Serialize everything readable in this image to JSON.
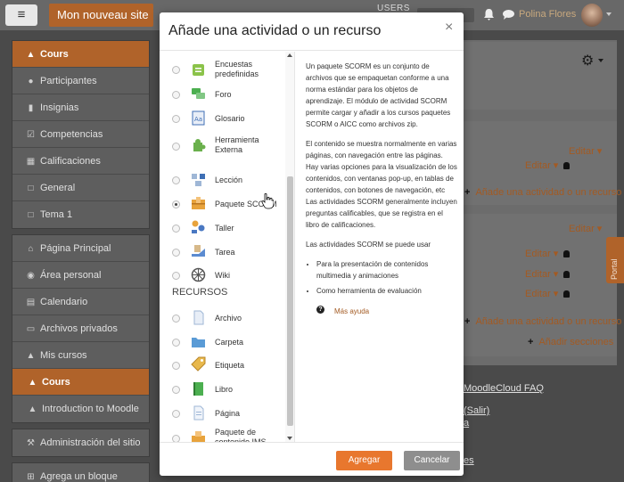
{
  "navbar": {
    "site_name": "Mon nouveau site",
    "users_label": "USERS",
    "user_name": "Polina Flores"
  },
  "sidebar": {
    "course_group": [
      {
        "label": "Cours",
        "icon": "graduation-cap-icon",
        "active": true
      },
      {
        "label": "Participantes",
        "icon": "users-icon"
      },
      {
        "label": "Insignias",
        "icon": "shield-icon"
      },
      {
        "label": "Competencias",
        "icon": "checkbox-icon"
      },
      {
        "label": "Calificaciones",
        "icon": "table-icon"
      },
      {
        "label": "General",
        "icon": "folder-icon"
      },
      {
        "label": "Tema 1",
        "icon": "folder-icon"
      }
    ],
    "site_group": [
      {
        "label": "Página Principal",
        "icon": "home-icon"
      },
      {
        "label": "Área personal",
        "icon": "dashboard-icon"
      },
      {
        "label": "Calendario",
        "icon": "calendar-icon"
      },
      {
        "label": "Archivos privados",
        "icon": "file-icon"
      },
      {
        "label": "Mis cursos",
        "icon": "graduation-cap-icon"
      },
      {
        "label": "Cours",
        "icon": "graduation-cap-icon",
        "active": true
      },
      {
        "label": "Introduction to Moodle",
        "icon": "graduation-cap-icon",
        "indent": true
      }
    ],
    "admin_item": {
      "label": "Administración del sitio",
      "icon": "wrench-icon"
    },
    "add_block_item": {
      "label": "Agrega un bloque",
      "icon": "plus-square-icon"
    }
  },
  "background": {
    "edit_label": "Editar",
    "add_activity_label": "Añade una actividad o un recurso",
    "add_sections_label": "Añadir secciones",
    "faq_link": "MoodleCloud FAQ",
    "logout_link": "(Salir)",
    "partial_link_1": "a",
    "partial_link_2": "es",
    "portal_label": "Portal"
  },
  "modal": {
    "title": "Añade una actividad o un recurso",
    "close_glyph": "×",
    "activities": [
      {
        "label": "Encuestas predefinidas",
        "icon": "survey-icon",
        "color": "#8bc34a"
      },
      {
        "label": "Foro",
        "icon": "forum-icon",
        "color": "#4caf50"
      },
      {
        "label": "Glosario",
        "icon": "glossary-icon",
        "color": "#3f6fb5"
      },
      {
        "label": "Herramienta Externa",
        "icon": "puzzle-icon",
        "color": "#6ab04c"
      },
      {
        "label": "Lección",
        "icon": "lesson-icon",
        "color": "#3f6fb5"
      },
      {
        "label": "Paquete SCORM",
        "icon": "scorm-icon",
        "color": "#e8a33c",
        "selected": true
      },
      {
        "label": "Taller",
        "icon": "workshop-icon",
        "color": "#4a78c2"
      },
      {
        "label": "Tarea",
        "icon": "assignment-icon",
        "color": "#5b8bd0"
      },
      {
        "label": "Wiki",
        "icon": "wiki-icon",
        "color": "#555555"
      }
    ],
    "resources_heading": "RECURSOS",
    "resources": [
      {
        "label": "Archivo",
        "icon": "file-icon",
        "color": "#9fb7d6"
      },
      {
        "label": "Carpeta",
        "icon": "folder-icon",
        "color": "#5a9bd6"
      },
      {
        "label": "Etiqueta",
        "icon": "tag-icon",
        "color": "#e8b84c"
      },
      {
        "label": "Libro",
        "icon": "book-icon",
        "color": "#4caf50"
      },
      {
        "label": "Página",
        "icon": "page-icon",
        "color": "#9fb7d6"
      },
      {
        "label": "Paquete de contenido IMS",
        "icon": "ims-icon",
        "color": "#e8a33c"
      }
    ],
    "description": {
      "p1": "Un paquete SCORM es un conjunto de archivos que se empaquetan conforme a una norma estándar para los objetos de aprendizaje. El módulo de actividad SCORM permite cargar y añadir a los cursos paquetes SCORM o AICC como archivos zip.",
      "p2": "El contenido se muestra normalmente en varias páginas, con navegación entre las páginas. Hay varias opciones para la visualización de los contenidos, con ventanas pop-up, en tablas de contenidos, con botones de navegación, etc Las actividades SCORM generalmente incluyen preguntas calificables, que se registra en el libro de calificaciones.",
      "p3": "Las actividades SCORM se puede usar",
      "bullets": [
        "Para la presentación de contenidos multimedia y animaciones",
        "Como herramienta de evaluación"
      ],
      "help_link": "Más ayuda"
    },
    "add_button": "Agregar",
    "cancel_button": "Cancelar"
  },
  "colors": {
    "accent": "#e8772e",
    "brand_orange": "#b0632a",
    "link": "#a35a22"
  }
}
